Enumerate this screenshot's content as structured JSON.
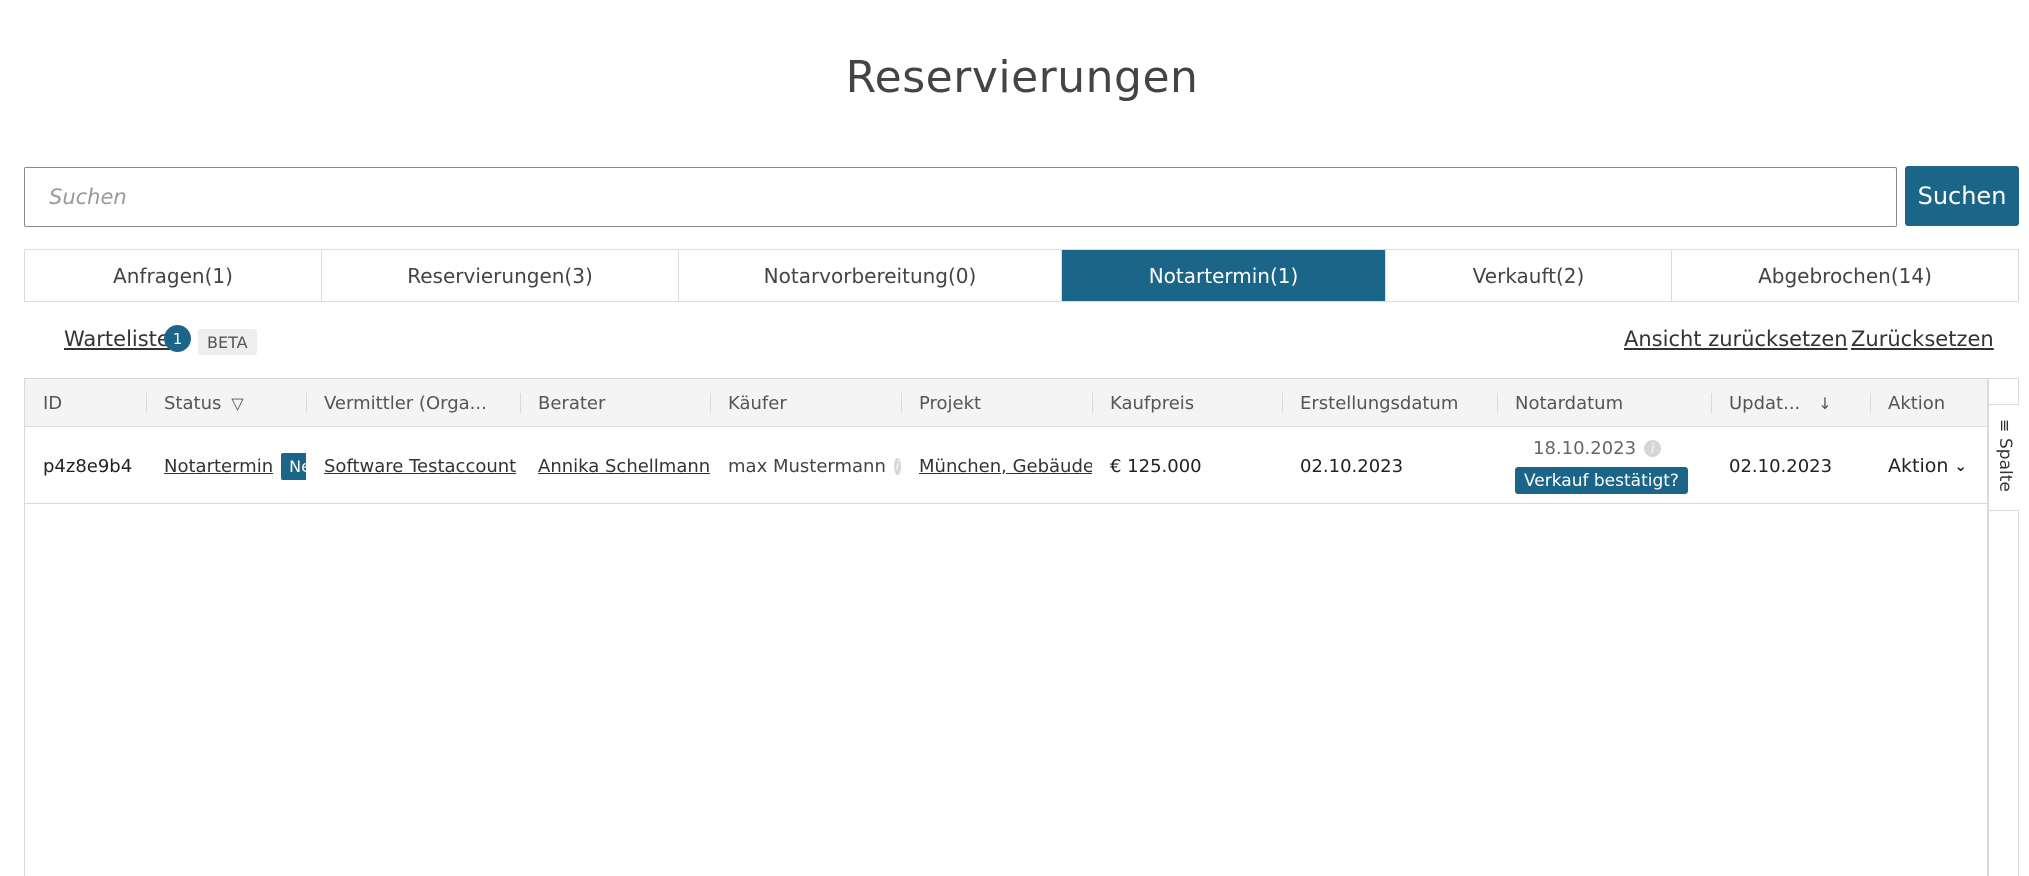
{
  "page": {
    "title": "Reservierungen"
  },
  "search": {
    "placeholder": "Suchen",
    "button_label": "Suchen"
  },
  "tabs": [
    {
      "label": "Anfragen(1)",
      "active": false
    },
    {
      "label": "Reservierungen(3)",
      "active": false
    },
    {
      "label": "Notarvorbereitung(0)",
      "active": false
    },
    {
      "label": "Notartermin(1)",
      "active": true
    },
    {
      "label": "Verkauft(2)",
      "active": false
    },
    {
      "label": "Abgebrochen(14)",
      "active": false
    }
  ],
  "toolbar": {
    "waitlist_label": "Warteliste",
    "waitlist_count": "1",
    "beta_label": "BETA",
    "reset_view_label": "Ansicht zurücksetzen",
    "reset_label": "Zurücksetzen"
  },
  "table": {
    "columns": [
      {
        "label": "ID"
      },
      {
        "label": "Status",
        "icon": "filter-icon"
      },
      {
        "label": "Vermittler (Orga..."
      },
      {
        "label": "Berater"
      },
      {
        "label": "Käufer"
      },
      {
        "label": "Projekt"
      },
      {
        "label": "Kaufpreis"
      },
      {
        "label": "Erstellungsdatum"
      },
      {
        "label": "Notardatum"
      },
      {
        "label": "Updat...",
        "icon": "sort-down-icon"
      },
      {
        "label": "Aktion"
      }
    ],
    "rows": [
      {
        "id": "p4z8e9b4",
        "status": "Notartermin",
        "status_badge": "Neu",
        "vermittler": "Software Testaccount",
        "berater": "Annika Schellmann",
        "kaeufer": "max Mustermann",
        "projekt": "München, Gebäude ei",
        "kaufpreis": "€ 125.000",
        "erstellungsdatum": "02.10.2023",
        "notardatum": "18.10.2023",
        "notar_button": "Verkauf bestätigt?",
        "updated": "02.10.2023",
        "aktion": "Aktion"
      }
    ]
  },
  "sidebar": {
    "columns_label": "Spalte",
    "icon": "columns-icon"
  },
  "colors": {
    "accent": "#1b6589",
    "header_bg": "#f4f4f4",
    "border": "#dadada"
  }
}
